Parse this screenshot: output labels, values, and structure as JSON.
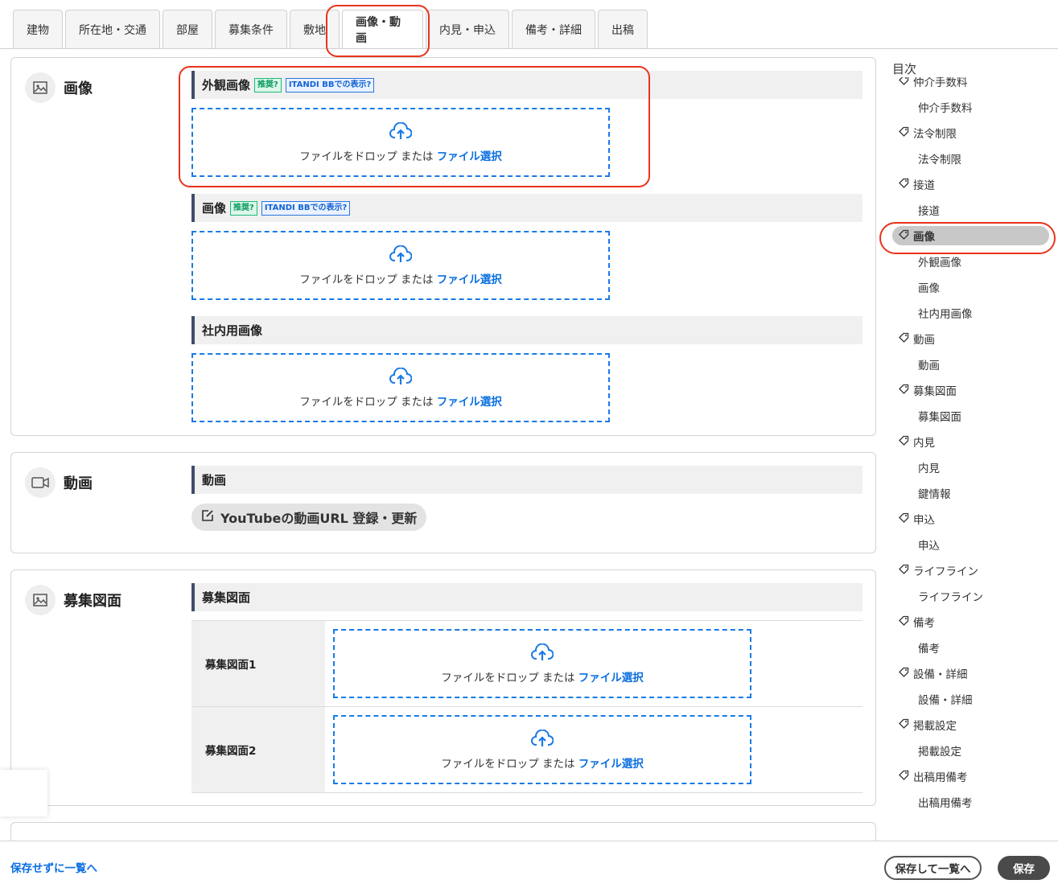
{
  "tabs": [
    {
      "label": "建物"
    },
    {
      "label": "所在地・交通"
    },
    {
      "label": "部屋"
    },
    {
      "label": "募集条件"
    },
    {
      "label": "敷地"
    },
    {
      "label": "画像・動画"
    },
    {
      "label": "内見・申込"
    },
    {
      "label": "備考・詳細"
    },
    {
      "label": "出稿"
    }
  ],
  "active_tab": "画像・動画",
  "dropzone": {
    "text": "ファイルをドロップ または ",
    "select": "ファイル選択"
  },
  "badges": {
    "recommended": "推奨",
    "itandi": "ITANDI BBでの表示"
  },
  "image_section": {
    "title": "画像",
    "fields": [
      {
        "label": "外観画像"
      },
      {
        "label": "画像"
      },
      {
        "label": "社内用画像"
      }
    ]
  },
  "video_section": {
    "title": "動画",
    "field_label": "動画",
    "youtube_button": "YouTubeの動画URL 登録・更新"
  },
  "floorplan_section": {
    "title": "募集図面",
    "field_label": "募集図面",
    "rows": [
      {
        "label": "募集図面1"
      },
      {
        "label": "募集図面2"
      }
    ]
  },
  "toc": {
    "title": "目次",
    "items": [
      {
        "label": "仲介手数料",
        "level": "parent"
      },
      {
        "label": "仲介手数料",
        "level": "child"
      },
      {
        "label": "法令制限",
        "level": "parent"
      },
      {
        "label": "法令制限",
        "level": "child"
      },
      {
        "label": "接道",
        "level": "parent"
      },
      {
        "label": "接道",
        "level": "child"
      },
      {
        "label": "画像",
        "level": "parent",
        "active": true
      },
      {
        "label": "外観画像",
        "level": "child"
      },
      {
        "label": "画像",
        "level": "child"
      },
      {
        "label": "社内用画像",
        "level": "child"
      },
      {
        "label": "動画",
        "level": "parent"
      },
      {
        "label": "動画",
        "level": "child"
      },
      {
        "label": "募集図面",
        "level": "parent"
      },
      {
        "label": "募集図面",
        "level": "child"
      },
      {
        "label": "内見",
        "level": "parent"
      },
      {
        "label": "内見",
        "level": "child"
      },
      {
        "label": "鍵情報",
        "level": "child"
      },
      {
        "label": "申込",
        "level": "parent"
      },
      {
        "label": "申込",
        "level": "child"
      },
      {
        "label": "ライフライン",
        "level": "parent"
      },
      {
        "label": "ライフライン",
        "level": "child"
      },
      {
        "label": "備考",
        "level": "parent"
      },
      {
        "label": "備考",
        "level": "child"
      },
      {
        "label": "設備・詳細",
        "level": "parent"
      },
      {
        "label": "設備・詳細",
        "level": "child"
      },
      {
        "label": "掲載設定",
        "level": "parent"
      },
      {
        "label": "掲載設定",
        "level": "child"
      },
      {
        "label": "出稿用備考",
        "level": "parent"
      },
      {
        "label": "出稿用備考",
        "level": "child"
      }
    ]
  },
  "footer": {
    "back_link": "保存せずに一覧へ",
    "save_and_list": "保存して一覧へ",
    "save": "保存"
  },
  "colors": {
    "highlight": "#e8331d",
    "link": "#0b6fe0",
    "dropzone_border": "#1a7ae6",
    "field_accent": "#3f4d6b"
  },
  "icons": {
    "image": "image-icon",
    "video": "video-camera-icon",
    "upload": "cloud-upload-icon",
    "edit": "edit-icon",
    "tag": "tag-icon",
    "help": "question-circle-icon"
  }
}
